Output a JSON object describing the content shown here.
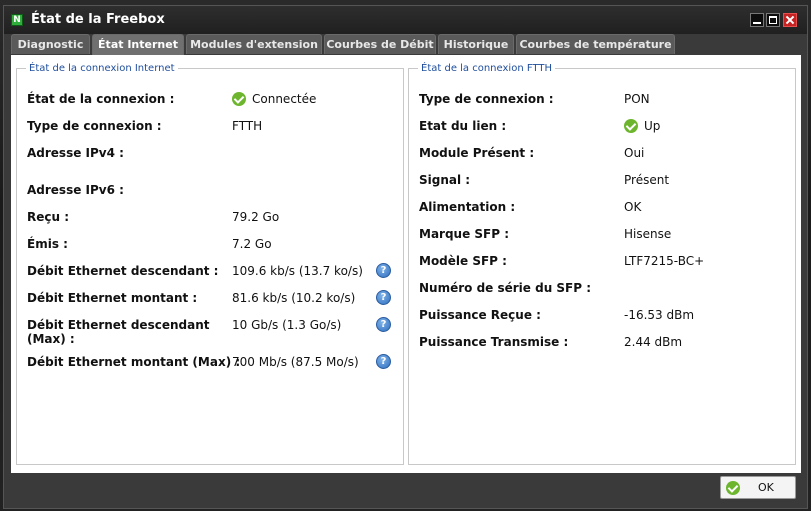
{
  "window": {
    "title": "État de la Freebox",
    "app_icon": "freebox-icon",
    "controls": [
      "minimize-icon",
      "maximize-icon",
      "close-icon"
    ]
  },
  "tabs": [
    {
      "label": "Diagnostic"
    },
    {
      "label": "État Internet",
      "active": true
    },
    {
      "label": "Modules d'extension"
    },
    {
      "label": "Courbes de Débit"
    },
    {
      "label": "Historique"
    },
    {
      "label": "Courbes de température"
    }
  ],
  "internet_panel": {
    "legend": "État de la connexion Internet",
    "rows": [
      {
        "label": "État de la connexion :",
        "value": "Connectée"
      },
      {
        "label": "Type de connexion :",
        "value": "FTTH"
      },
      {
        "label": "Adresse IPv4 :",
        "value": ""
      },
      {
        "label": "Adresse IPv6 :",
        "value": ""
      },
      {
        "label": "Reçu :",
        "value": "79.2 Go"
      },
      {
        "label": "Émis :",
        "value": "7.2 Go"
      },
      {
        "label": "Débit Ethernet descendant :",
        "value": "109.6 kb/s (13.7 ko/s)"
      },
      {
        "label": "Débit Ethernet montant :",
        "value": "81.6 kb/s (10.2 ko/s)"
      },
      {
        "label": "Débit Ethernet descendant",
        "label2": "(Max) :",
        "value": "10 Gb/s (1.3 Go/s)"
      },
      {
        "label": "Débit Ethernet montant (Max) :",
        "value": "700 Mb/s (87.5 Mo/s)"
      }
    ]
  },
  "ftth_panel": {
    "legend": "État de la connexion FTTH",
    "rows": [
      {
        "label": "Type de connexion :",
        "value": "PON"
      },
      {
        "label": "Etat du lien :",
        "value": "Up"
      },
      {
        "label": "Module Présent :",
        "value": "Oui"
      },
      {
        "label": "Signal :",
        "value": "Présent"
      },
      {
        "label": "Alimentation :",
        "value": "OK"
      },
      {
        "label": "Marque SFP :",
        "value": "Hisense"
      },
      {
        "label": "Modèle SFP :",
        "value": "LTF7215-BC+"
      },
      {
        "label": "Numéro de série du SFP :",
        "value": ""
      },
      {
        "label": "Puissance Reçue :",
        "value": "-16.53 dBm"
      },
      {
        "label": "Puissance Transmise :",
        "value": "2.44 dBm"
      }
    ]
  },
  "footer": {
    "ok_label": "OK"
  },
  "colors": {
    "accent_legend": "#1f4e9c",
    "status_ok": "#6cb52d",
    "help_icon": "#2f6fc0"
  }
}
